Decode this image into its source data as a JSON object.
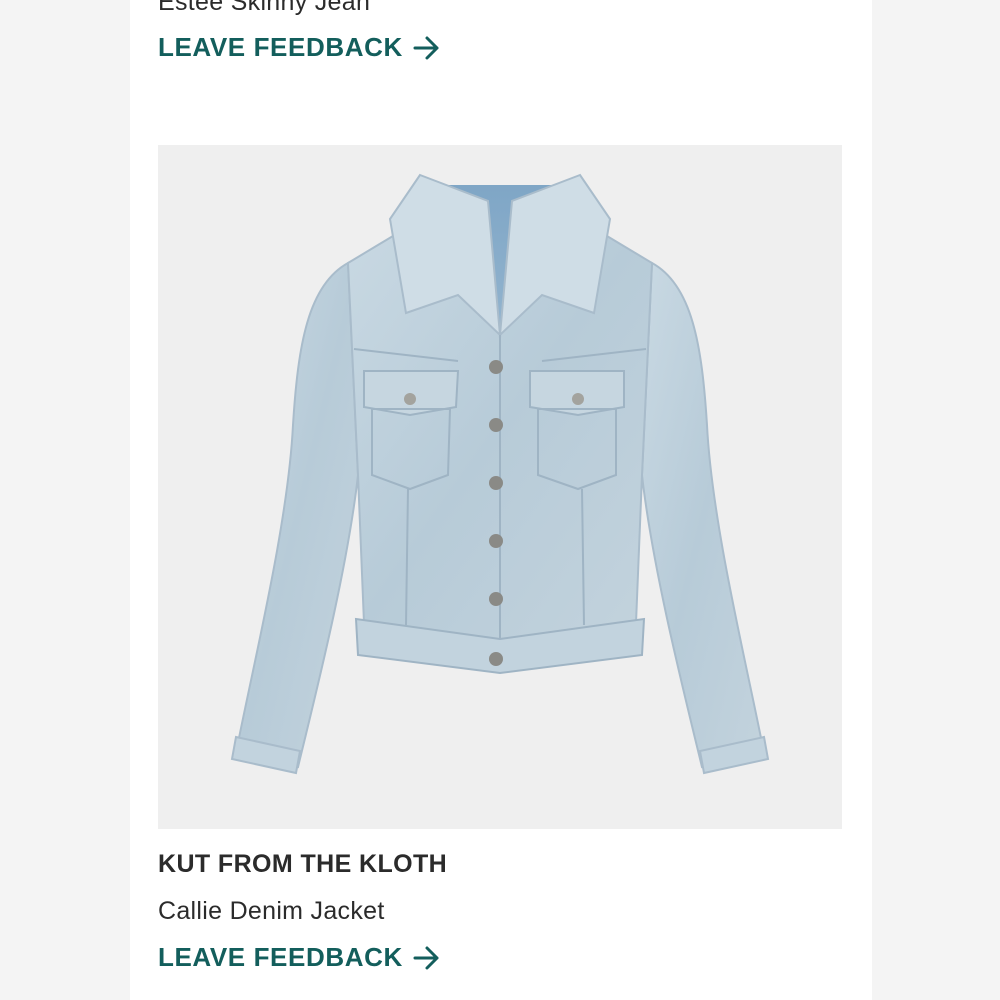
{
  "previous_item": {
    "product_name": "Estee Skinny Jean",
    "feedback_label": "LEAVE FEEDBACK"
  },
  "current_item": {
    "brand": "KUT FROM THE KLOTH",
    "product_name": "Callie Denim Jacket",
    "feedback_label": "LEAVE FEEDBACK",
    "image_icon": "denim-jacket-image"
  },
  "colors": {
    "accent": "#135e5c",
    "text": "#2b2b2b",
    "card_background": "#ffffff",
    "page_background": "#f4f4f4",
    "image_background": "#efefef"
  }
}
